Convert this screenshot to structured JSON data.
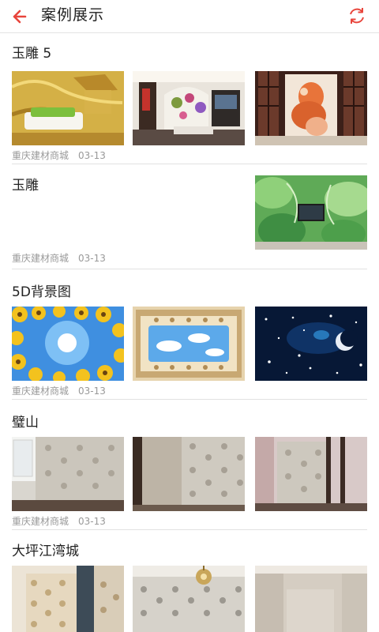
{
  "header": {
    "title": "案例展示",
    "back_icon": "arrow-left-icon",
    "refresh_icon": "refresh-icon",
    "accent_color": "#e8453c"
  },
  "cases": [
    {
      "title": "玉雕 5",
      "source": "重庆建材商城",
      "date": "03-13",
      "images": [
        "jade-carving-sofa-photo",
        "living-room-flower-wall-photo",
        "carved-screen-buddha-photo"
      ]
    },
    {
      "title": "玉雕",
      "source": "重庆建材商城",
      "date": "03-13",
      "images": [
        "jade-leaf-tv-wall-photo"
      ]
    },
    {
      "title": "5D背景图",
      "source": "重庆建材商城",
      "date": "03-13",
      "images": [
        "sunflower-sky-photo",
        "framed-sky-ceiling-photo",
        "starry-night-moon-photo"
      ]
    },
    {
      "title": "璧山",
      "source": "重庆建材商城",
      "date": "03-13",
      "images": [
        "damask-wallpaper-corner-photo",
        "damask-wallpaper-room-photo",
        "damask-wallpaper-doorway-photo"
      ]
    },
    {
      "title": "大坪江湾城",
      "source": "",
      "date": "",
      "images": [
        "damask-entry-hall-photo",
        "damask-chandelier-photo",
        "plain-wall-room-photo"
      ]
    }
  ]
}
